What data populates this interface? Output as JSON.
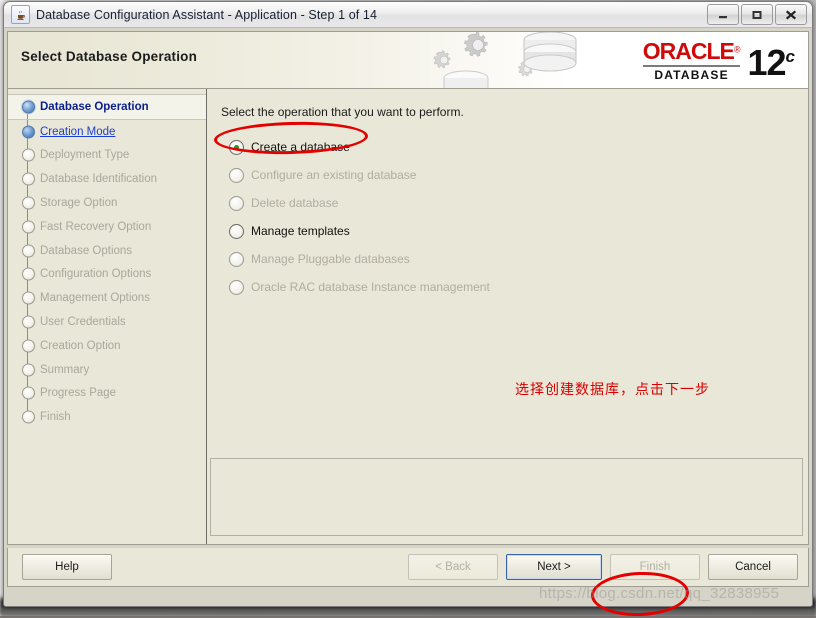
{
  "window": {
    "title": "Database Configuration Assistant - Application - Step 1 of 14",
    "app_icon": "java-coffee-cup-icon",
    "controls": {
      "minimize": "–",
      "maximize": "❑",
      "close": "✕"
    }
  },
  "banner": {
    "title": "Select Database Operation",
    "brand": {
      "name": "ORACLE",
      "registered": "®",
      "product": "DATABASE",
      "version": "12",
      "edition": "c"
    }
  },
  "sidebar": {
    "steps": [
      {
        "label": "Database Operation",
        "state": "active"
      },
      {
        "label": "Creation Mode",
        "state": "done"
      },
      {
        "label": "Deployment Type",
        "state": "disabled"
      },
      {
        "label": "Database Identification",
        "state": "disabled"
      },
      {
        "label": "Storage Option",
        "state": "disabled"
      },
      {
        "label": "Fast Recovery Option",
        "state": "disabled"
      },
      {
        "label": "Database Options",
        "state": "disabled"
      },
      {
        "label": "Configuration Options",
        "state": "disabled"
      },
      {
        "label": "Management Options",
        "state": "disabled"
      },
      {
        "label": "User Credentials",
        "state": "disabled"
      },
      {
        "label": "Creation Option",
        "state": "disabled"
      },
      {
        "label": "Summary",
        "state": "disabled"
      },
      {
        "label": "Progress Page",
        "state": "disabled"
      },
      {
        "label": "Finish",
        "state": "disabled"
      }
    ]
  },
  "main": {
    "prompt": "Select the operation that you want to perform.",
    "options": [
      {
        "label": "Create a database",
        "mnemonic": "C",
        "selected": true,
        "enabled": true
      },
      {
        "label": "Configure an existing database",
        "mnemonic": "o",
        "selected": false,
        "enabled": false
      },
      {
        "label": "Delete database",
        "mnemonic": "D",
        "selected": false,
        "enabled": false
      },
      {
        "label": "Manage templates",
        "mnemonic": "t",
        "selected": false,
        "enabled": true
      },
      {
        "label": "Manage Pluggable databases",
        "mnemonic": "P",
        "selected": false,
        "enabled": false
      },
      {
        "label": "Oracle RAC database Instance management",
        "mnemonic": "I",
        "selected": false,
        "enabled": false
      }
    ],
    "annotation": "选择创建数据库，点击下一步"
  },
  "footer": {
    "help": "Help",
    "back": "< Back",
    "next": "Next >",
    "finish": "Finish",
    "cancel": "Cancel"
  },
  "overlay": {
    "watermark": "https://blog.csdn.net/qq_32838955",
    "highlight_color": "#e50000"
  }
}
